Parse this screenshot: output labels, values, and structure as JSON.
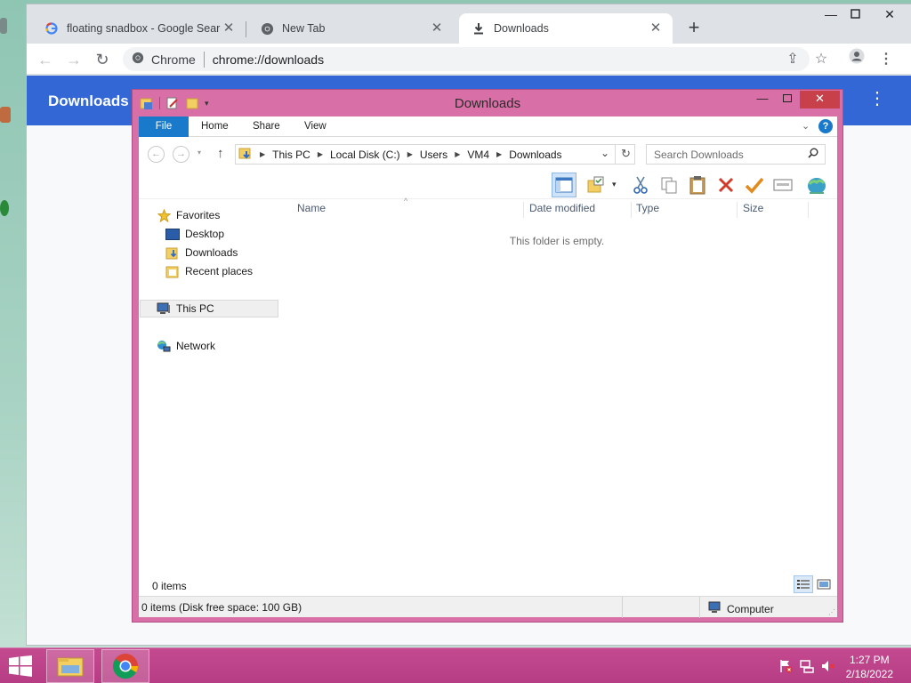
{
  "chrome": {
    "tabs": [
      {
        "title": "floating snadbox - Google Search",
        "favicon": "google-icon"
      },
      {
        "title": "New Tab",
        "favicon": "chrome-icon"
      },
      {
        "title": "Downloads",
        "favicon": "download-icon"
      }
    ],
    "omnibox": {
      "site": "Chrome",
      "url": "chrome://downloads"
    },
    "page_title": "Downloads"
  },
  "explorer": {
    "title": "Downloads",
    "ribbon_tabs": [
      "File",
      "Home",
      "Share",
      "View"
    ],
    "breadcrumb": [
      "This PC",
      "Local Disk (C:)",
      "Users",
      "VM4",
      "Downloads"
    ],
    "search_placeholder": "Search Downloads",
    "nav": {
      "favorites": "Favorites",
      "desktop": "Desktop",
      "downloads": "Downloads",
      "recent": "Recent places",
      "this_pc": "This PC",
      "network": "Network"
    },
    "columns": {
      "name": "Name",
      "date": "Date modified",
      "type": "Type",
      "size": "Size"
    },
    "empty_message": "This folder is empty.",
    "item_count": "0 items",
    "status_left": "0 items (Disk free space: 100 GB)",
    "status_right": "Computer"
  },
  "taskbar": {
    "time": "1:27 PM",
    "date": "2/18/2022"
  },
  "colors": {
    "chrome_header": "#3367d6",
    "window_frame": "#d96fa7",
    "taskbar": "#b63d84",
    "file_tab": "#1979ca"
  }
}
